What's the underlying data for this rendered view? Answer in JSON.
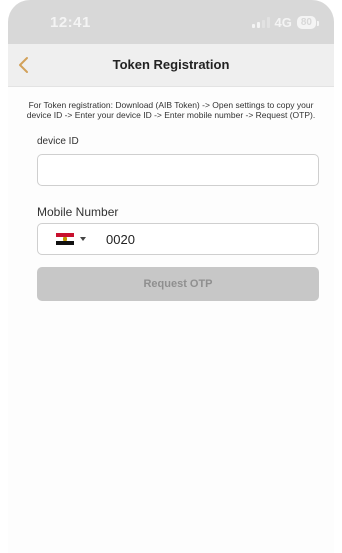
{
  "status_bar": {
    "time": "12:41",
    "network": "4G",
    "battery": "80"
  },
  "nav": {
    "title": "Token Registration",
    "back_icon": "chevron-left-icon",
    "accent_color": "#d2a15a"
  },
  "instructions": "For Token registration: Download (AIB Token) -> Open settings to copy your device ID -> Enter your device ID -> Enter mobile number -> Request (OTP).",
  "form": {
    "device_id": {
      "label": "device ID",
      "value": "",
      "placeholder": ""
    },
    "mobile": {
      "label": "Mobile Number",
      "country_flag": "egypt-flag-icon",
      "value": "0020"
    },
    "request_button": {
      "label": "Request OTP",
      "state": "disabled"
    }
  }
}
